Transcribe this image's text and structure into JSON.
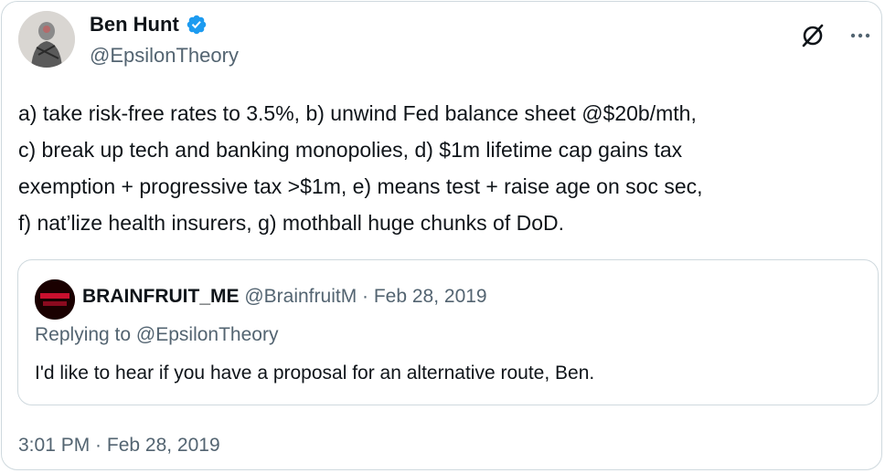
{
  "tweet": {
    "author_name": "Ben Hunt",
    "author_handle": "@EpsilonTheory",
    "verified": true,
    "verified_color": "#1d9bf0",
    "icons": [
      "verified-badge-icon",
      "grok-icon",
      "more-options-icon"
    ],
    "text": "a) take risk-free rates to 3.5%, b) unwind Fed balance sheet @$20b/mth,\nc) break up tech and banking monopolies, d) $1m lifetime cap gains tax\nexemption + progressive tax >$1m, e) means test + raise age on soc sec,\nf) nat’lize health insurers, g) mothball huge chunks of DoD.",
    "timestamp": "3:01 PM · Feb 28, 2019"
  },
  "quoted_tweet": {
    "author_name": "BRAINFRUIT_ME",
    "meta": "@BrainfruitM · Feb 28, 2019",
    "replying_to": "Replying to @EpsilonTheory",
    "text": "I'd like to hear if you have a proposal for an alternative route, Ben.",
    "avatar_color": "#c8102e"
  },
  "colors": {
    "text_primary": "#0f1419",
    "text_secondary": "#536471",
    "border": "#cfd9de"
  }
}
